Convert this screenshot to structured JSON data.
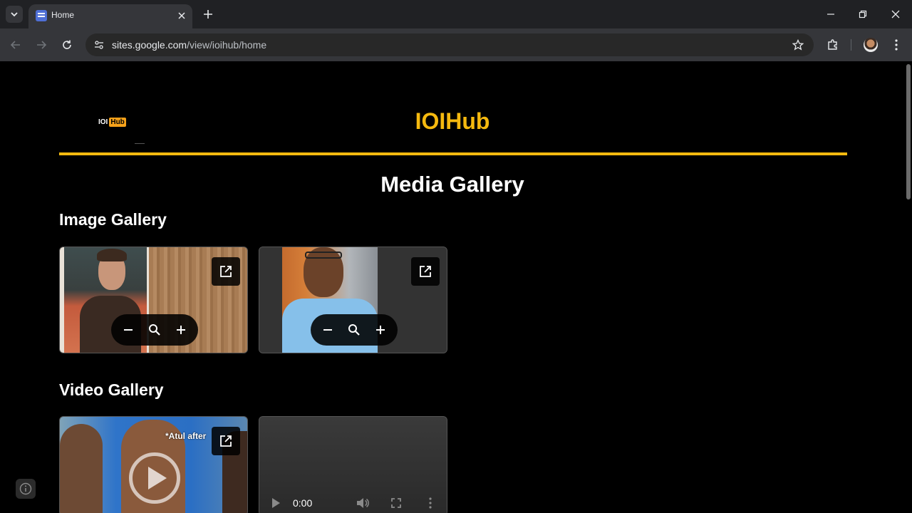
{
  "browser": {
    "tab_title": "Home",
    "url_host": "sites.google.com",
    "url_path": "/view/ioihub/home"
  },
  "site": {
    "logo_text": "IOI",
    "logo_badge": "Hub",
    "title": "IOIHub",
    "accent_color": "#f5b90f"
  },
  "page": {
    "heading": "Media Gallery",
    "image_gallery": {
      "heading": "Image Gallery",
      "images": [
        {
          "subject": "man in brown shirt"
        },
        {
          "subject": "man with glasses in blue shirt"
        }
      ]
    },
    "video_gallery": {
      "heading": "Video Gallery",
      "videos": [
        {
          "caption": "*Atul after"
        },
        {
          "time": "0:00"
        }
      ]
    }
  },
  "icons": {
    "open_in_new": "open-in-new-icon",
    "zoom_out": "minus-icon",
    "zoom": "zoom-icon",
    "zoom_in": "plus-icon",
    "info": "info-icon"
  }
}
